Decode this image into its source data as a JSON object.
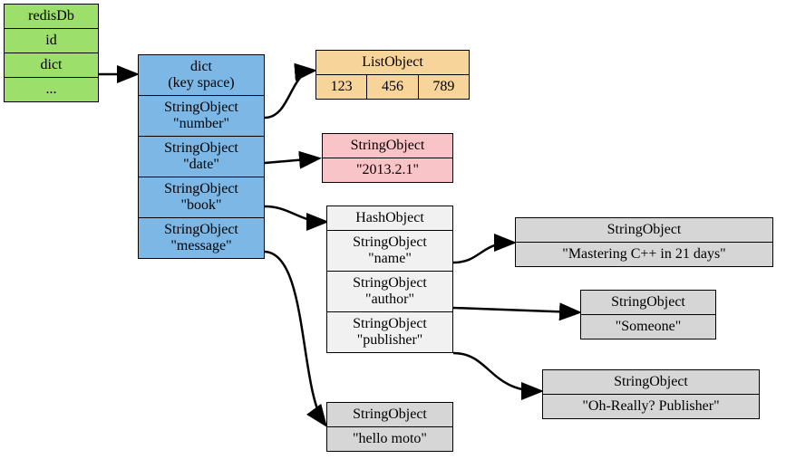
{
  "redisDb": {
    "title": "redisDb",
    "row1": "id",
    "row2": "dict",
    "row3": "..."
  },
  "dict": {
    "title": "dict\n(key space)",
    "k1": "StringObject\n\"number\"",
    "k2": "StringObject\n\"date\"",
    "k3": "StringObject\n\"book\"",
    "k4": "StringObject\n\"message\""
  },
  "list": {
    "title": "ListObject",
    "v1": "123",
    "v2": "456",
    "v3": "789"
  },
  "dateStr": {
    "title": "StringObject",
    "value": "\"2013.2.1\""
  },
  "hash": {
    "title": "HashObject",
    "f1": "StringObject\n\"name\"",
    "f2": "StringObject\n\"author\"",
    "f3": "StringObject\n\"publisher\""
  },
  "msg": {
    "title": "StringObject",
    "value": "\"hello moto\""
  },
  "name": {
    "title": "StringObject",
    "value": "\"Mastering C++ in 21 days\""
  },
  "author": {
    "title": "StringObject",
    "value": "\"Someone\""
  },
  "publisher": {
    "title": "StringObject",
    "value": "\"Oh-Really? Publisher\""
  }
}
